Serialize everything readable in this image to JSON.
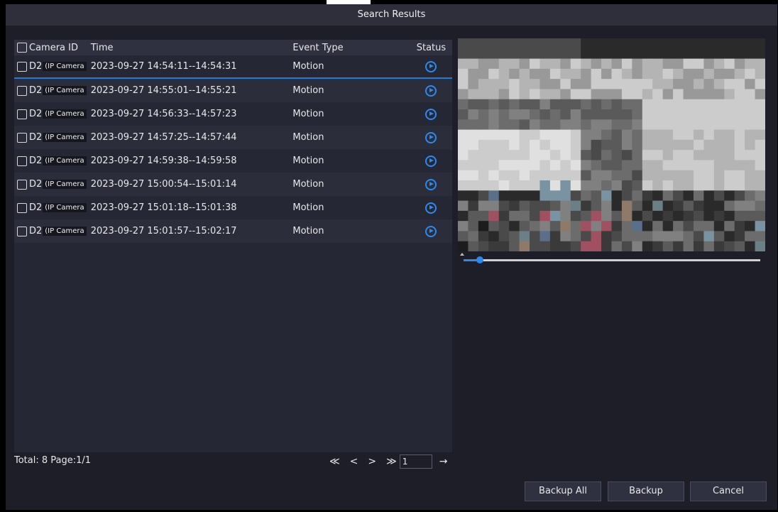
{
  "dialog": {
    "title": "Search Results"
  },
  "table": {
    "headers": {
      "camera_id": "Camera ID",
      "time": "Time",
      "event_type": "Event Type",
      "status": "Status"
    },
    "rows": [
      {
        "camera": "D2",
        "camera_tag": "(IP Camera",
        "time": "2023-09-27 14:54:11--14:54:31",
        "event": "Motion"
      },
      {
        "camera": "D2",
        "camera_tag": "(IP Camera",
        "time": "2023-09-27 14:55:01--14:55:21",
        "event": "Motion"
      },
      {
        "camera": "D2",
        "camera_tag": "(IP Camera",
        "time": "2023-09-27 14:56:33--14:57:23",
        "event": "Motion"
      },
      {
        "camera": "D2",
        "camera_tag": "(IP Camera",
        "time": "2023-09-27 14:57:25--14:57:44",
        "event": "Motion"
      },
      {
        "camera": "D2",
        "camera_tag": "(IP Camera",
        "time": "2023-09-27 14:59:38--14:59:58",
        "event": "Motion"
      },
      {
        "camera": "D2",
        "camera_tag": "(IP Camera",
        "time": "2023-09-27 15:00:54--15:01:14",
        "event": "Motion"
      },
      {
        "camera": "D2",
        "camera_tag": "(IP Camera",
        "time": "2023-09-27 15:01:18--15:01:38",
        "event": "Motion"
      },
      {
        "camera": "D2",
        "camera_tag": "(IP Camera",
        "time": "2023-09-27 15:01:57--15:02:17",
        "event": "Motion"
      }
    ]
  },
  "footer": {
    "summary": "Total: 8  Page:1/1",
    "page_input": "1"
  },
  "pager": {
    "first": "≪",
    "prev": "<",
    "next": ">",
    "last": "≫",
    "go": "→"
  },
  "buttons": {
    "backup_all": "Backup All",
    "backup": "Backup",
    "cancel": "Cancel"
  },
  "colors": {
    "accent": "#2b8af0",
    "dialog_bg": "#1d1e28",
    "title_bg": "#2e2f3b"
  },
  "icons": {
    "status": "play-circle-icon"
  }
}
